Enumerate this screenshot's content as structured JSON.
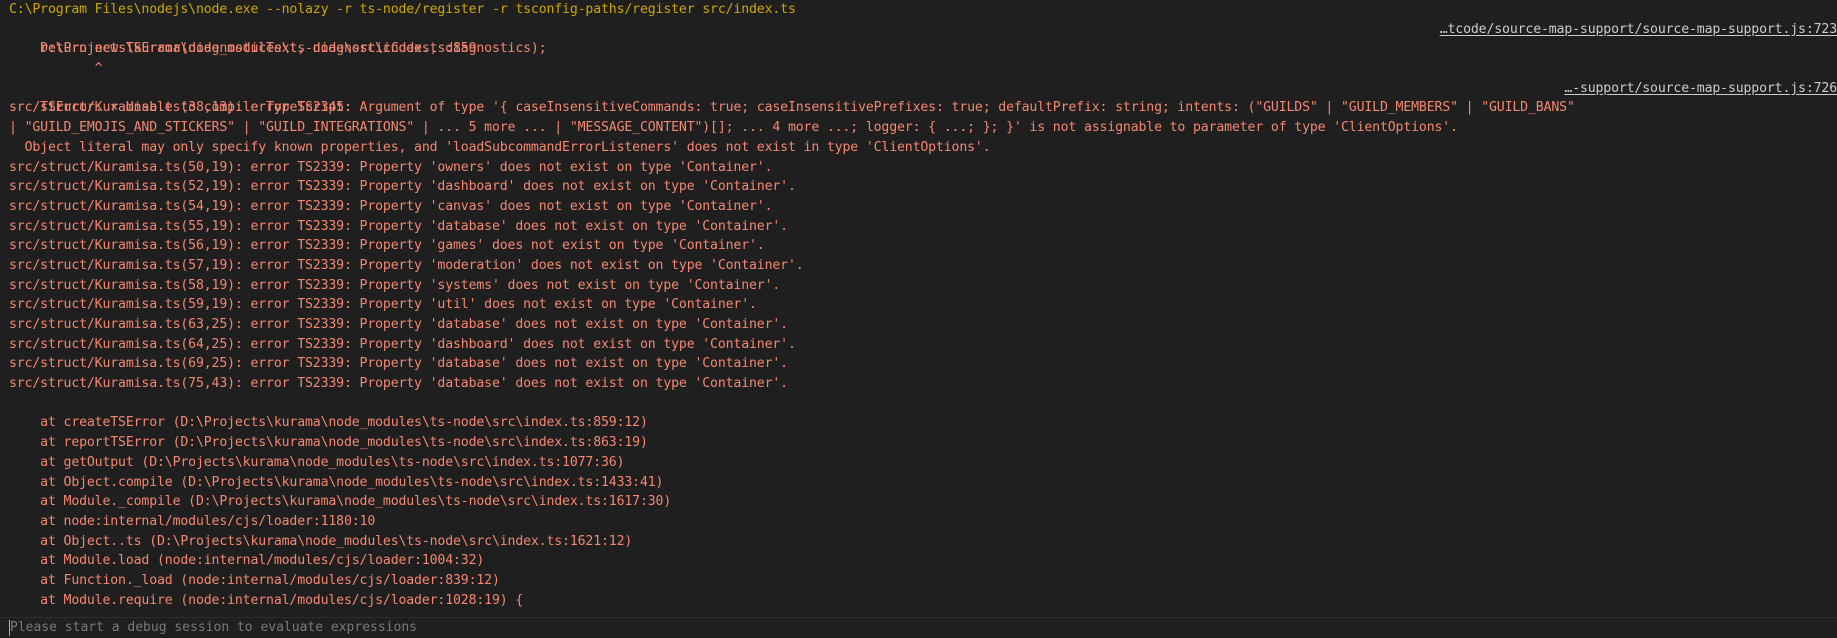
{
  "command": "C:\\Program Files\\nodejs\\node.exe --nolazy -r ts-node/register -r tsconfig-paths/register src/index.ts",
  "header": {
    "location": "D:\\Projects\\kurama\\node_modules\\ts-node\\src\\index.ts:859",
    "location_link": "…tcode/source-map-support/source-map-support.js:723",
    "code_line": "    return new TSError(diagnosticText, diagnosticCodes, diagnostics);",
    "caret_line": "           ^"
  },
  "error_title": "TSError: × Unable to compile TypeScript:",
  "error_link": "…-support/source-map-support.js:726",
  "ts2345": [
    "src/struct/Kuramisa.ts(38,13): error TS2345: Argument of type '{ caseInsensitiveCommands: true; caseInsensitivePrefixes: true; defaultPrefix: string; intents: (\"GUILDS\" | \"GUILD_MEMBERS\" | \"GUILD_BANS\"",
    "| \"GUILD_EMOJIS_AND_STICKERS\" | \"GUILD_INTEGRATIONS\" | ... 5 more ... | \"MESSAGE_CONTENT\")[]; ... 4 more ...; logger: { ...; }; }' is not assignable to parameter of type 'ClientOptions'.",
    "  Object literal may only specify known properties, and 'loadSubcommandErrorListeners' does not exist in type 'ClientOptions'."
  ],
  "ts2339_errors": [
    "src/struct/Kuramisa.ts(50,19): error TS2339: Property 'owners' does not exist on type 'Container'.",
    "src/struct/Kuramisa.ts(52,19): error TS2339: Property 'dashboard' does not exist on type 'Container'.",
    "src/struct/Kuramisa.ts(54,19): error TS2339: Property 'canvas' does not exist on type 'Container'.",
    "src/struct/Kuramisa.ts(55,19): error TS2339: Property 'database' does not exist on type 'Container'.",
    "src/struct/Kuramisa.ts(56,19): error TS2339: Property 'games' does not exist on type 'Container'.",
    "src/struct/Kuramisa.ts(57,19): error TS2339: Property 'moderation' does not exist on type 'Container'.",
    "src/struct/Kuramisa.ts(58,19): error TS2339: Property 'systems' does not exist on type 'Container'.",
    "src/struct/Kuramisa.ts(59,19): error TS2339: Property 'util' does not exist on type 'Container'.",
    "src/struct/Kuramisa.ts(63,25): error TS2339: Property 'database' does not exist on type 'Container'.",
    "src/struct/Kuramisa.ts(64,25): error TS2339: Property 'dashboard' does not exist on type 'Container'.",
    "src/struct/Kuramisa.ts(69,25): error TS2339: Property 'database' does not exist on type 'Container'.",
    "src/struct/Kuramisa.ts(75,43): error TS2339: Property 'database' does not exist on type 'Container'."
  ],
  "stack": [
    "    at createTSError (D:\\Projects\\kurama\\node_modules\\ts-node\\src\\index.ts:859:12)",
    "    at reportTSError (D:\\Projects\\kurama\\node_modules\\ts-node\\src\\index.ts:863:19)",
    "    at getOutput (D:\\Projects\\kurama\\node_modules\\ts-node\\src\\index.ts:1077:36)",
    "    at Object.compile (D:\\Projects\\kurama\\node_modules\\ts-node\\src\\index.ts:1433:41)",
    "    at Module._compile (D:\\Projects\\kurama\\node_modules\\ts-node\\src\\index.ts:1617:30)",
    "    at node:internal/modules/cjs/loader:1180:10",
    "    at Object..ts (D:\\Projects\\kurama\\node_modules\\ts-node\\src\\index.ts:1621:12)",
    "    at Module.load (node:internal/modules/cjs/loader:1004:32)",
    "    at Function._load (node:internal/modules/cjs/loader:839:12)",
    "    at Module.require (node:internal/modules/cjs/loader:1028:19) {"
  ],
  "input": {
    "placeholder": "Please start a debug session to evaluate expressions"
  },
  "colors": {
    "background": "#1f1f1f",
    "command": "#cca700",
    "error": "#f48771",
    "link": "#cccccc",
    "placeholder": "#7a7a7a"
  }
}
